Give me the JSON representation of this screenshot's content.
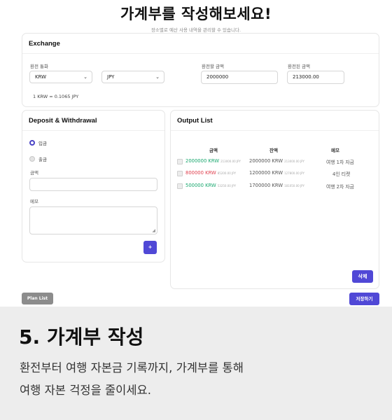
{
  "header": {
    "title": "가계부를 작성해보세요!",
    "subtitle": "장소별로 예산 사용 내역을 관리할 수 있습니다."
  },
  "exchange": {
    "title": "Exchange",
    "currency_label": "환전 통화",
    "from_currency": "KRW",
    "to_currency": "JPY",
    "amount_label": "환전할 금액",
    "amount_value": "2000000",
    "result_label": "환전된 금액",
    "result_value": "213000.00",
    "rate_text": "1 KRW = 0.1065 JPY"
  },
  "deposit": {
    "title": "Deposit & Withdrawal",
    "options": [
      "입금",
      "출금"
    ],
    "selected": "입금",
    "amount_label": "금액",
    "memo_label": "메모",
    "add_label": "+"
  },
  "output": {
    "title": "Output List",
    "columns": [
      "금액",
      "잔액",
      "메모"
    ],
    "rows": [
      {
        "amount": "2000000 KRW",
        "amount_sub": "213000.00 JPY",
        "type": "deposit",
        "balance": "2000000 KRW",
        "balance_sub": "213000.00 JPY",
        "memo": "여행 1차 자금"
      },
      {
        "amount": "800000 KRW",
        "amount_sub": "85200.00 JPY",
        "type": "withdraw",
        "balance": "1200000 KRW",
        "balance_sub": "127800.00 JPY",
        "memo": "4인 티켓"
      },
      {
        "amount": "500000 KRW",
        "amount_sub": "53250.00 JPY",
        "type": "deposit",
        "balance": "1700000 KRW",
        "balance_sub": "181050.00 JPY",
        "memo": "여행 2차 자금"
      }
    ],
    "delete_label": "삭제"
  },
  "actions": {
    "plan_list_label": "Plan List",
    "save_label": "저장하기"
  },
  "footer": {
    "title": "5. 가계부 작성",
    "line1": "환전부터 여행 자본금 기록까지, 가계부를 통해",
    "line2": "여행 자본 걱정을 줄이세요."
  },
  "colors": {
    "accent": "#5048d6",
    "deposit": "#1aa86f",
    "withdraw": "#e0414f",
    "footer_bg": "#ededed"
  }
}
